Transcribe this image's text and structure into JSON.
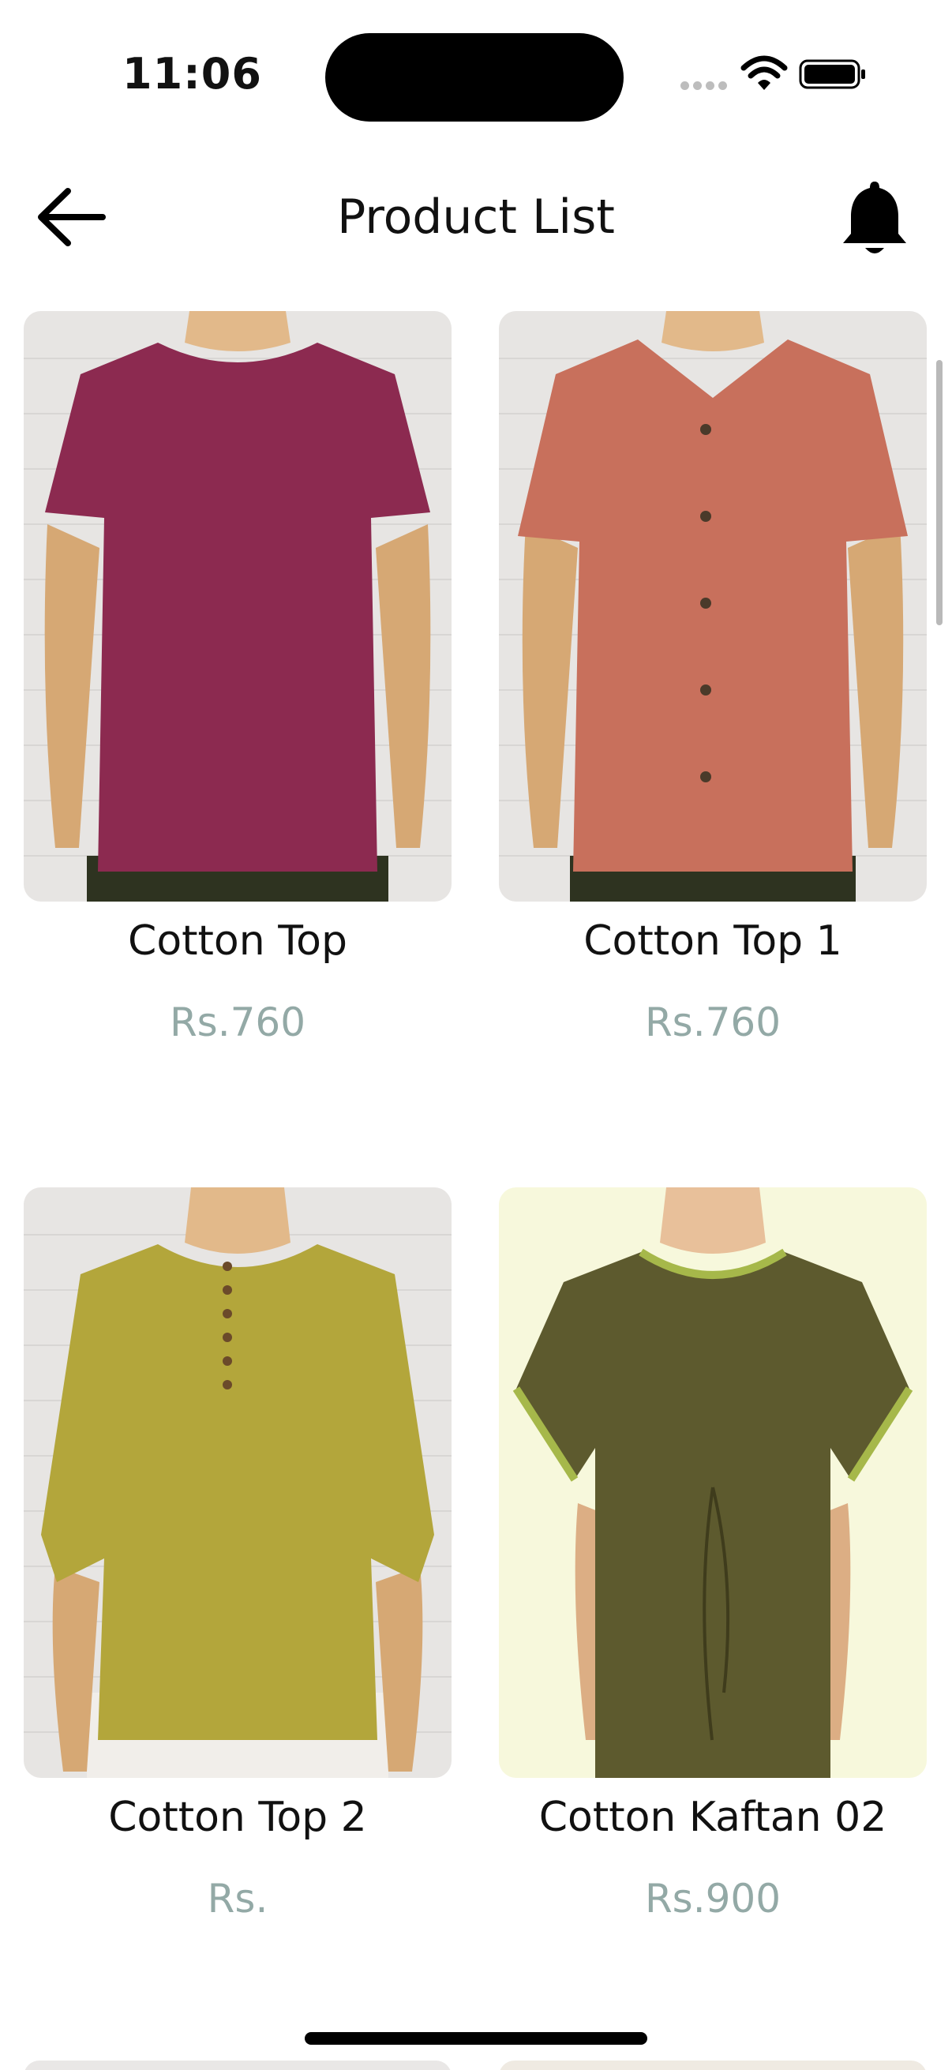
{
  "status_bar": {
    "time": "11:06",
    "icons": [
      "cellular-signal-icon",
      "wifi-icon",
      "battery-icon"
    ]
  },
  "nav": {
    "title": "Product List",
    "back_icon": "arrow-left-icon",
    "notification_icon": "bell-icon"
  },
  "products": [
    {
      "name": "Cotton Top",
      "price": "Rs.760",
      "image_color": "#8c2a50",
      "image": "garment-photo"
    },
    {
      "name": "Cotton Top 1",
      "price": "Rs.760",
      "image_color": "#c8705c",
      "image": "garment-photo"
    },
    {
      "name": "Cotton Top 2",
      "price": "Rs.",
      "image_color": "#b3a63b",
      "image": "garment-photo"
    },
    {
      "name": "Cotton Kaftan 02",
      "price": "Rs.900",
      "image_color": "#5d5a2e",
      "image": "garment-photo"
    }
  ],
  "colors": {
    "price": "#93a9a6",
    "text": "#111111",
    "background": "#ffffff"
  }
}
